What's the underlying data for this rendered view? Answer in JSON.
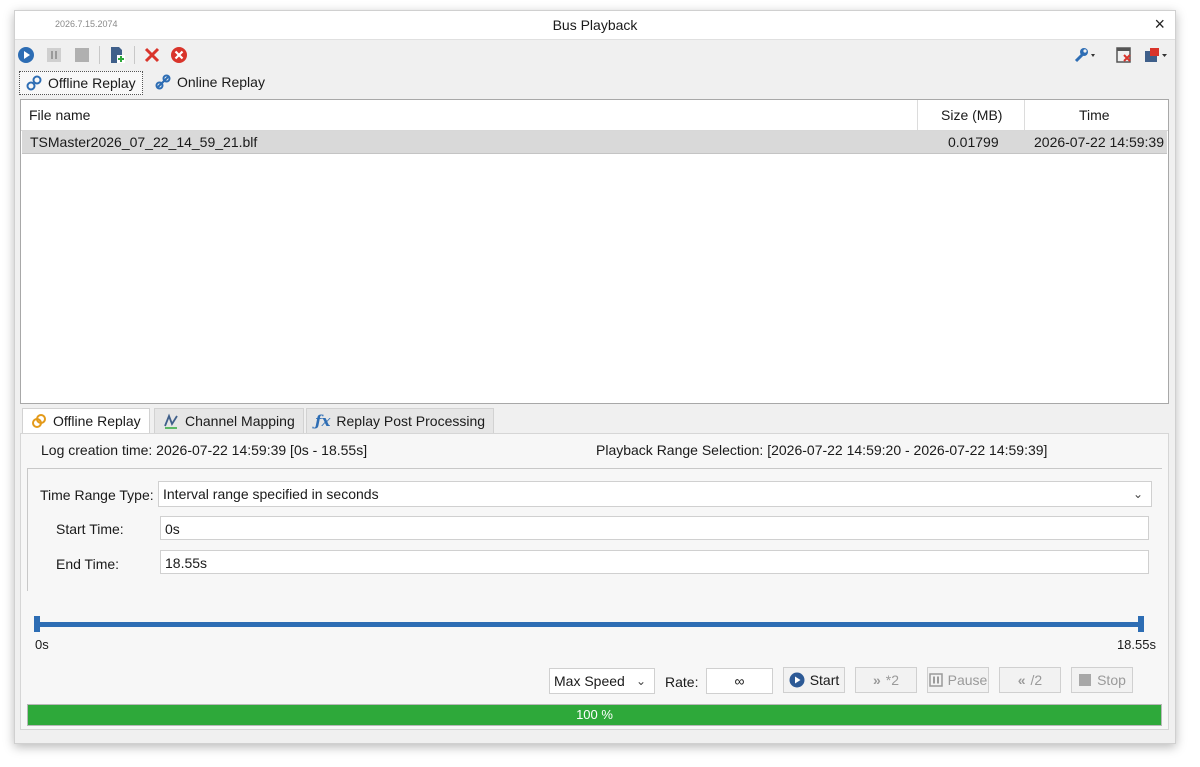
{
  "window": {
    "version": "2026.7.15.2074",
    "title": "Bus Playback",
    "close_icon": "×"
  },
  "toolbar": {
    "icons": [
      "play-icon",
      "pause-icon",
      "stop-icon",
      "add-file-icon",
      "delete-icon",
      "clear-all-icon",
      "wrench-icon",
      "remove-window-icon",
      "layout-icon"
    ]
  },
  "top_tabs": {
    "offline": "Offline Replay",
    "online": "Online Replay",
    "active": "offline"
  },
  "file_list": {
    "columns": {
      "name": "File name",
      "size": "Size (MB)",
      "time": "Time"
    },
    "rows": [
      {
        "name": "TSMaster2026_07_22_14_59_21.blf",
        "size": "0.01799",
        "time": "2026-07-22 14:59:39"
      }
    ]
  },
  "inner_tabs": {
    "offline": "Offline Replay",
    "mapping": "Channel Mapping",
    "post": "Replay Post Processing",
    "active": "offline"
  },
  "info": {
    "log_creation": "Log creation time: 2026-07-22 14:59:39 [0s - 18.55s]",
    "range_selection": "Playback Range Selection: [2026-07-22 14:59:20 - 2026-07-22 14:59:39]"
  },
  "form": {
    "time_range_type_label": "Time Range Type:",
    "time_range_type_value": "Interval range specified in seconds",
    "start_time_label": "Start Time:",
    "start_time_value": "0s",
    "end_time_label": "End Time:",
    "end_time_value": "18.55s"
  },
  "slider": {
    "min_label": "0s",
    "max_label": "18.55s",
    "start_fraction": 0.0,
    "end_fraction": 1.0
  },
  "controls": {
    "speed_value": "Max Speed",
    "rate_label": "Rate:",
    "rate_value": "∞",
    "start_label": "Start",
    "faster_label": "*2",
    "pause_label": "Pause",
    "slower_label": "/2",
    "stop_label": "Stop"
  },
  "progress": {
    "percent": 100,
    "label": "100 %"
  },
  "colors": {
    "accent": "#2d6db4",
    "progress": "#2ea93a",
    "delete": "#d9342b"
  }
}
